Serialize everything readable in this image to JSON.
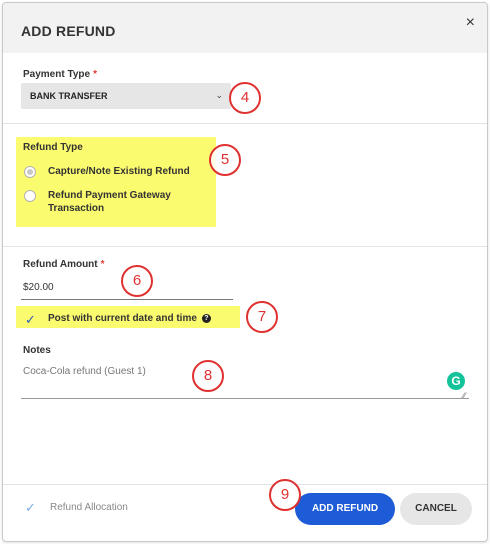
{
  "dialog": {
    "title": "ADD REFUND",
    "close_label": "×"
  },
  "payment_type": {
    "label": "Payment Type",
    "required_mark": "*",
    "selected": "BANK TRANSFER",
    "callout": "4"
  },
  "refund_type": {
    "label": "Refund Type",
    "options": [
      {
        "label": "Capture/Note Existing Refund",
        "selected": true
      },
      {
        "label": "Refund Payment Gateway Transaction",
        "selected": false
      }
    ],
    "callout": "5"
  },
  "refund_amount": {
    "label": "Refund Amount",
    "required_mark": "*",
    "value": "$20.00",
    "callout": "6"
  },
  "post_current": {
    "label": "Post with current date and time",
    "checked": true,
    "help_icon": "question-icon",
    "callout": "7"
  },
  "notes": {
    "label": "Notes",
    "value": "Coca-Cola refund (Guest 1)",
    "grammarly": "G",
    "callout": "8"
  },
  "footer": {
    "refund_allocation_label": "Refund Allocation",
    "add_refund_label": "ADD REFUND",
    "cancel_label": "CANCEL",
    "callout": "9"
  },
  "colors": {
    "highlight": "#fbfb6f",
    "primary_button": "#1e5bd7",
    "callout": "#e03131"
  }
}
